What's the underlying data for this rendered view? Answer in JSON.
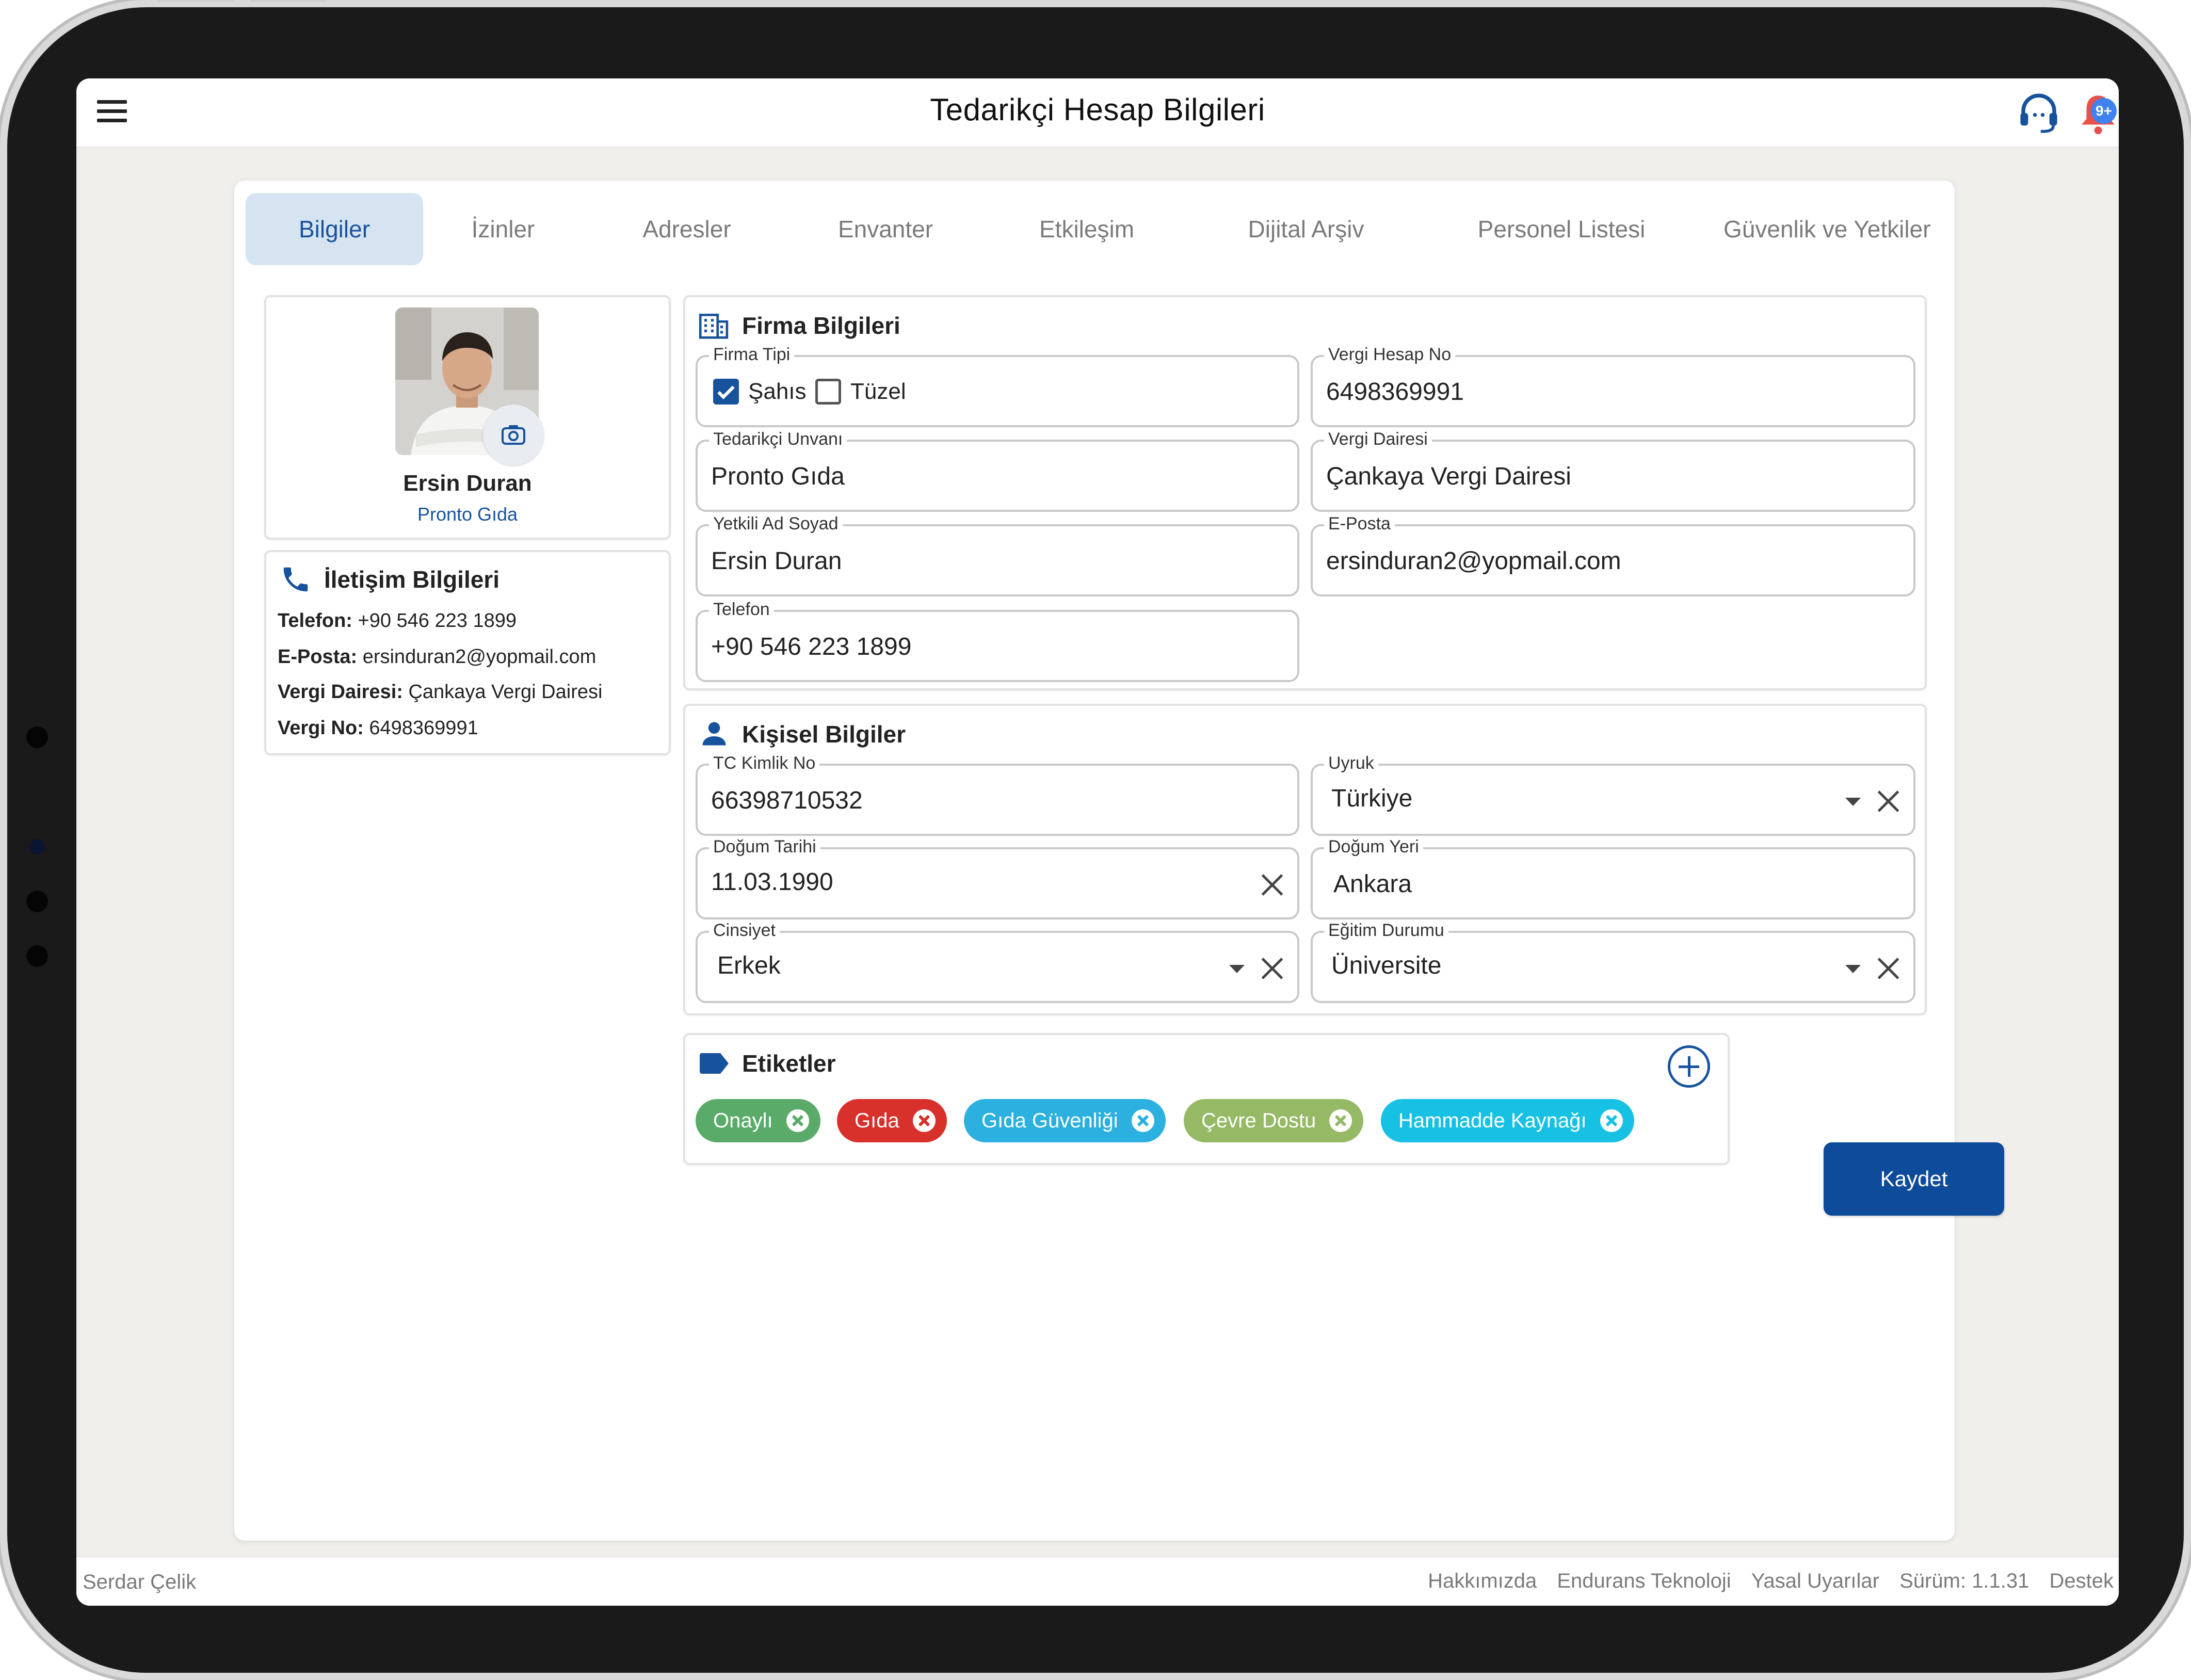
{
  "app": {
    "title": "Tedarikçi Hesap Bilgileri",
    "notification_count": "9+"
  },
  "tabs": [
    {
      "label": "Bilgiler"
    },
    {
      "label": "İzinler"
    },
    {
      "label": "Adresler"
    },
    {
      "label": "Envanter"
    },
    {
      "label": "Etkileşim"
    },
    {
      "label": "Dijital Arşiv"
    },
    {
      "label": "Personel Listesi"
    },
    {
      "label": "Güvenlik ve Yetkiler"
    }
  ],
  "profile": {
    "name": "Ersin Duran",
    "company": "Pronto Gıda"
  },
  "contact": {
    "title": "İletişim Bilgileri",
    "phone_label": "Telefon:",
    "phone": "+90 546 223 1899",
    "email_label": "E-Posta:",
    "email": "ersinduran2@yopmail.com",
    "tax_office_label": "Vergi Dairesi:",
    "tax_office": "Çankaya Vergi Dairesi",
    "tax_no_label": "Vergi No:",
    "tax_no": "6498369991"
  },
  "company": {
    "title": "Firma Bilgileri",
    "type_label": "Firma Tipi",
    "type_options": [
      {
        "label": "Şahıs",
        "checked": true
      },
      {
        "label": "Tüzel",
        "checked": false
      }
    ],
    "tax_account_label": "Vergi Hesap No",
    "tax_account": "6498369991",
    "supplier_title_label": "Tedarikçi Unvanı",
    "supplier_title": "Pronto Gıda",
    "tax_office_label": "Vergi Dairesi",
    "tax_office": "Çankaya Vergi Dairesi",
    "authorized_label": "Yetkili Ad Soyad",
    "authorized": "Ersin Duran",
    "email_label": "E-Posta",
    "email": "ersinduran2@yopmail.com",
    "phone_label": "Telefon",
    "phone": "+90 546 223 1899"
  },
  "personal": {
    "title": "Kişisel Bilgiler",
    "tc_label": "TC Kimlik No",
    "tc": "66398710532",
    "nationality_label": "Uyruk",
    "nationality": "Türkiye",
    "birth_date_label": "Doğum Tarihi",
    "birth_date": "11.03.1990",
    "birth_place_label": "Doğum Yeri",
    "birth_place": "Ankara",
    "gender_label": "Cinsiyet",
    "gender": "Erkek",
    "education_label": "Eğitim Durumu",
    "education": "Üniversite"
  },
  "tags": {
    "title": "Etiketler",
    "items": [
      {
        "label": "Onaylı",
        "color": "#5aab6a"
      },
      {
        "label": "Gıda",
        "color": "#d8302b"
      },
      {
        "label": "Gıda Güvenliği",
        "color": "#2bb0df"
      },
      {
        "label": "Çevre Dostu",
        "color": "#95b964"
      },
      {
        "label": "Hammadde Kaynağı",
        "color": "#17c1e3"
      }
    ]
  },
  "actions": {
    "save": "Kaydet"
  },
  "footer": {
    "user": "Serdar Çelik",
    "links": [
      "Hakkımızda",
      "Endurans Teknoloji",
      "Yasal Uyarılar",
      "Sürüm: 1.1.31",
      "Destek"
    ]
  },
  "colors": {
    "primary": "#0e4b9a",
    "accent": "#17529c",
    "tab_active_bg": "#d6e4f2",
    "background": "#f0efec"
  }
}
